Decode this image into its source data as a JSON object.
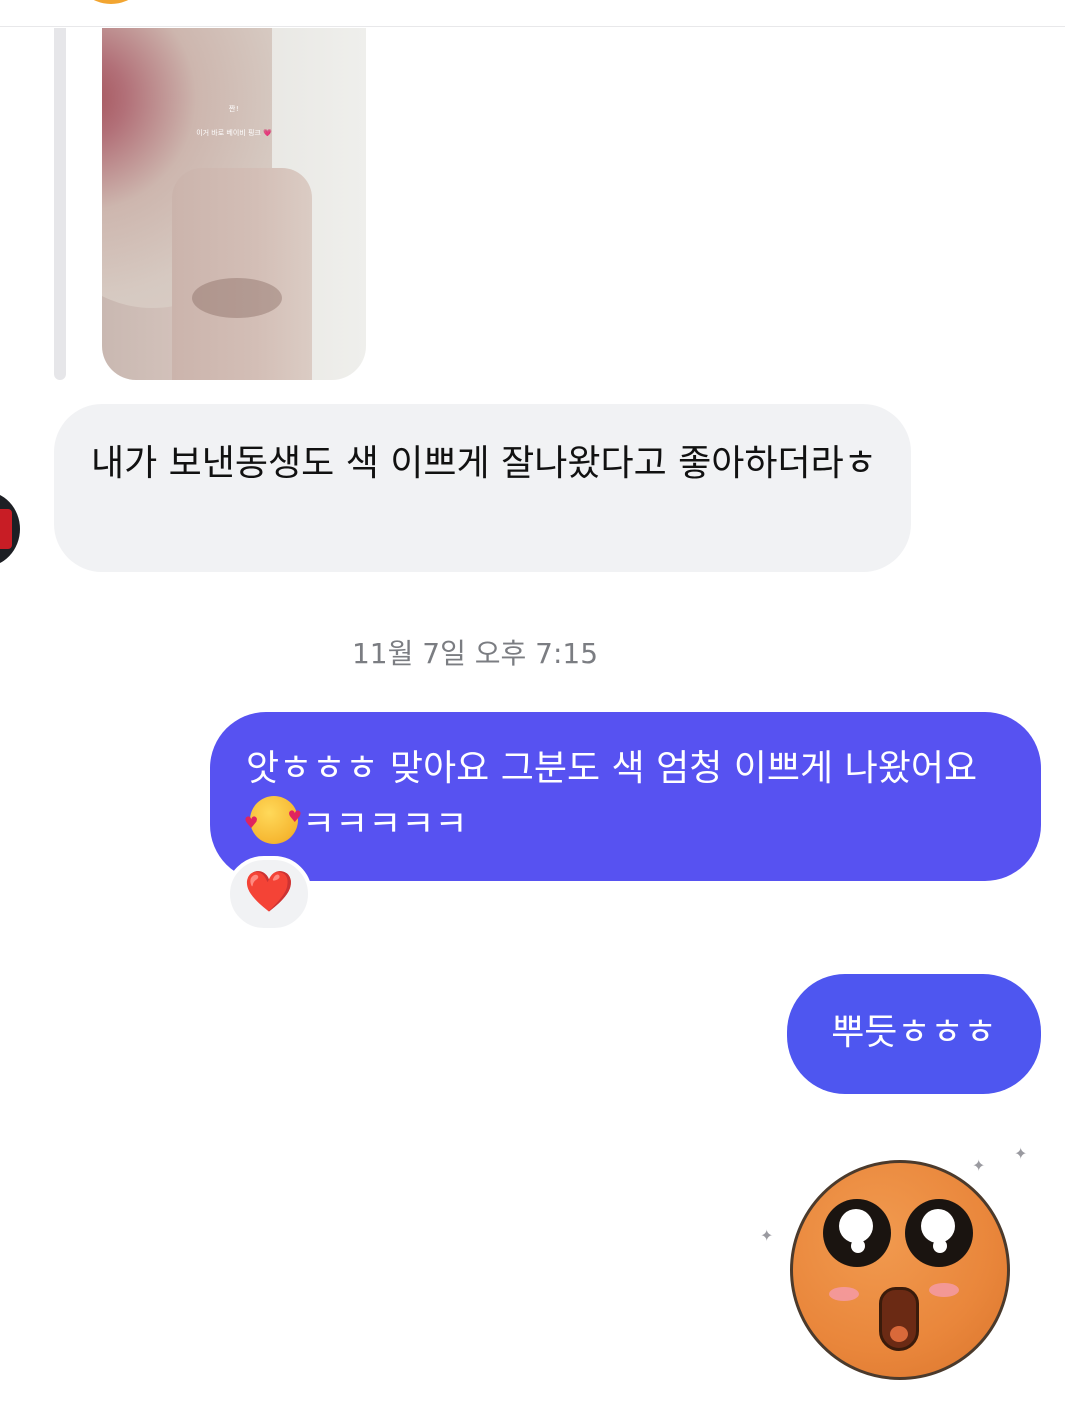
{
  "conversation": {
    "story_reply": {
      "caption_title": "짠!",
      "caption_text": "이거 바로 베이비 핑크 💗",
      "image_icon": "story-photo"
    },
    "incoming_message": {
      "text": "내가 보낸동생도 색 이쁘게 잘나왔다고 좋아하더라ㅎ"
    },
    "timestamp": "11월 7일 오후 7:15",
    "outgoing_messages": [
      {
        "text_before_emoji": "앗ㅎㅎㅎ 맞아요 그분도 색 엄청 이쁘게 나왔어요",
        "emoji": "smiling-face-with-hearts",
        "text_after_emoji": "ㅋㅋㅋㅋㅋ",
        "reaction": "❤️"
      },
      {
        "text": "뿌듯ㅎㅎㅎ"
      }
    ],
    "sticker": {
      "icon": "excited-orange-face-sticker"
    }
  },
  "colors": {
    "incoming_bubble": "#f1f2f4",
    "outgoing_bubble": "#5752f1",
    "outgoing_bubble_2": "#4e56f0",
    "timestamp_text": "#7b7d82",
    "reaction_heart": "#e0242b"
  }
}
